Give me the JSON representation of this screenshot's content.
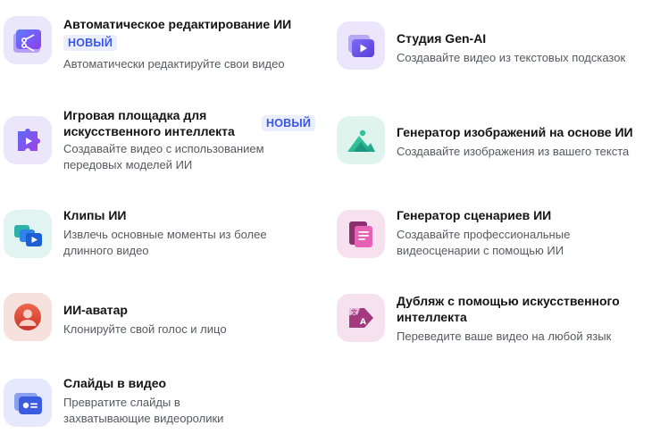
{
  "tools": [
    {
      "title": "Автоматическое редактирование ИИ",
      "badge": "НОВЫЙ",
      "desc": "Автоматически редактируйте свои видео",
      "icon": "auto-edit-icon"
    },
    {
      "title_line1": "Игровая площадка для",
      "title_line2": "искусственного интеллекта",
      "badge": "НОВЫЙ",
      "desc_line1": "Создавайте видео с использованием",
      "desc_line2": "передовых моделей ИИ",
      "icon": "ai-playground-icon"
    },
    {
      "title": "Клипы ИИ",
      "desc_line1": "Извлечь основные моменты из более",
      "desc_line2": "длинного видео",
      "icon": "ai-clips-icon"
    },
    {
      "title": "ИИ-аватар",
      "desc": "Клонируйте свой голос и лицо",
      "icon": "ai-avatar-icon"
    },
    {
      "title": "Слайды в видео",
      "desc_line1": "Превратите слайды в",
      "desc_line2": "захватывающие видеоролики",
      "icon": "slides-to-video-icon"
    },
    {
      "title": "Студия Gen-AI",
      "desc": "Создавайте видео из текстовых подсказок",
      "icon": "gen-ai-studio-icon"
    },
    {
      "title": "Генератор изображений на основе ИИ",
      "desc": "Создавайте изображения из вашего текста",
      "icon": "image-generator-icon"
    },
    {
      "title": "Генератор сценариев ИИ",
      "desc_line1": "Создавайте профессиональные",
      "desc_line2": "видеосценарии с помощью ИИ",
      "icon": "script-generator-icon"
    },
    {
      "title_line1": "Дубляж с помощью искусственного",
      "title_line2": "интеллекта",
      "desc": "Переведите ваше видео на любой язык",
      "icon": "ai-dubbing-icon"
    }
  ],
  "colors": {
    "badge_bg": "#ebeffd",
    "badge_text": "#3b55e6",
    "title": "#141414",
    "desc": "#555a60"
  }
}
